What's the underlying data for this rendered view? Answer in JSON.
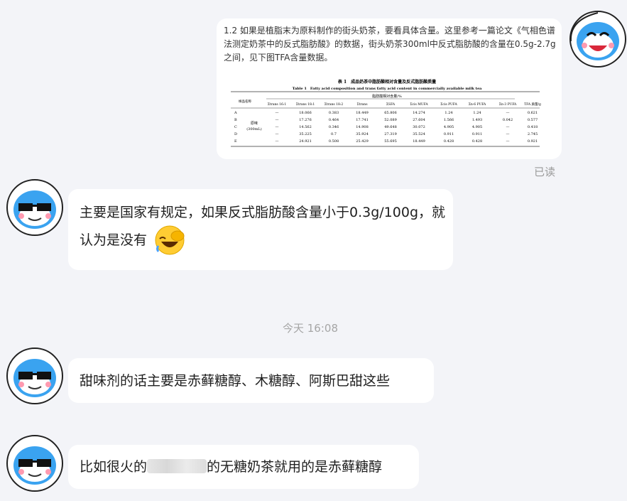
{
  "messages": {
    "outgoing": {
      "text": "1.2 如果是植脂末为原料制作的街头奶茶，要看具体含量。这里参考一篇论文《气相色谱法测定奶茶中的反式脂肪酸》的数据，街头奶茶300ml中反式脂肪酸的含量在0.5g-2.7g之间，见下图TFA含量数据。",
      "read_status": "已读",
      "table": {
        "title_cn": "表 1　成品奶茶中脂肪酸相对含量及反式脂肪酸质量",
        "title_en": "Table 1　Fatty acid composition and trans fatty acid content in commercially available milk tea",
        "group_header": "脂肪酸相对含量/%",
        "columns": [
          "样品名称",
          "Σtrans 16:1",
          "Σtrans 18:1",
          "Σtrans 18:2",
          "Σtrans",
          "ΣSFA",
          "Σcis MUFA",
          "Σcis PUFA",
          "Σn-6 PUFA",
          "Σn-3 PUFA",
          "TFA 质量/g"
        ],
        "sample_label": "原味",
        "sample_volume": "(300mL)",
        "rows": [
          [
            "A",
            "—",
            "18.066",
            "0.383",
            "18.449",
            "65.806",
            "14.274",
            "1.24",
            "1.24",
            "—",
            "0.621"
          ],
          [
            "B",
            "—",
            "17.276",
            "0.464",
            "17.741",
            "52.089",
            "27.604",
            "1.566",
            "1.493",
            "0.042",
            "0.577"
          ],
          [
            "C",
            "—",
            "14.562",
            "0.346",
            "14.908",
            "49.648",
            "30.072",
            "4.905",
            "4.905",
            "—",
            "0.418"
          ],
          [
            "D",
            "—",
            "35.225",
            "0.7",
            "35.924",
            "27.319",
            "35.524",
            "0.911",
            "0.911",
            "—",
            "2.745"
          ],
          [
            "E",
            "—",
            "24.921",
            "0.508",
            "25.429",
            "55.695",
            "18.449",
            "0.428",
            "0.428",
            "—",
            "0.921"
          ]
        ]
      }
    },
    "incoming_1": {
      "text": "主要是国家有规定，如果反式脂肪酸含量小于0.3g/100g，就认为是没有",
      "emoji": "facepalm-laugh-emoji"
    },
    "timestamp": "今天 16:08",
    "incoming_2": {
      "text": "甜味剂的话主要是赤藓糖醇、木糖醇、阿斯巴甜这些"
    },
    "incoming_3": {
      "text_before": "比如很火的",
      "text_after": "的无糖奶茶就用的是赤藓糖醇"
    }
  },
  "avatars": {
    "self": "smiling-mascot-avatar",
    "other": "sunglasses-mascot-avatar"
  },
  "colors": {
    "background": "#f3f4f8",
    "bubble": "#ffffff",
    "mascot_blue": "#3aa3f0",
    "muted_text": "#9a9a9a"
  }
}
